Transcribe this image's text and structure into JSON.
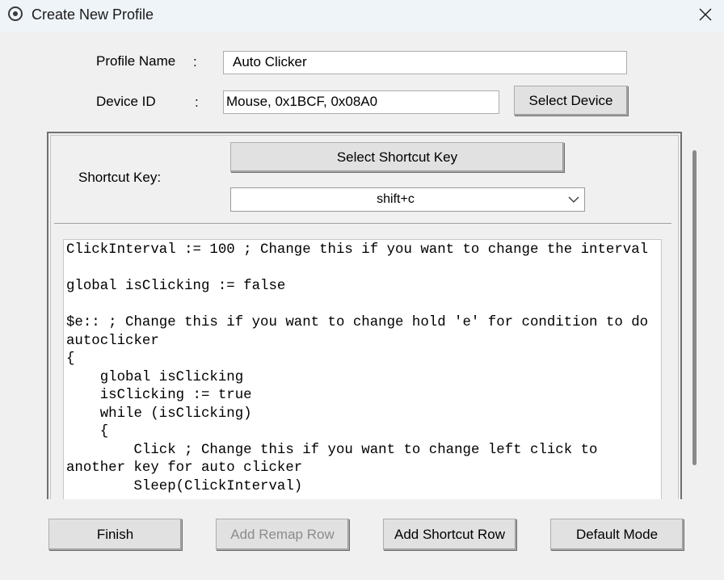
{
  "window": {
    "title": "Create New Profile",
    "icon": "radio-dot-icon",
    "close_icon": "close-icon"
  },
  "form": {
    "profile_name_label": "Profile Name",
    "profile_name_colon": ":",
    "profile_name_value": "Auto Clicker",
    "device_id_label": "Device ID",
    "device_id_colon": ":",
    "device_id_value": "Mouse, 0x1BCF, 0x08A0",
    "select_device_label": "Select Device"
  },
  "shortcut": {
    "label": "Shortcut Key:",
    "select_button_label": "Select Shortcut Key",
    "selected_value": "shift+c"
  },
  "script_lines": [
    "ClickInterval := 100 ; Change this if you want to change the interval",
    "",
    "global isClicking := false",
    "",
    "$e:: ; Change this if you want to change hold 'e' for condition to do autoclicker",
    "{",
    "    global isClicking",
    "    isClicking := true",
    "    while (isClicking)",
    "    {",
    "        Click ; Change this if you want to change left click to another key for auto clicker",
    "        Sleep(ClickInterval)"
  ],
  "footer": {
    "finish_label": "Finish",
    "add_remap_row_label": "Add Remap Row",
    "add_shortcut_row_label": "Add Shortcut Row",
    "default_mode_label": "Default Mode"
  },
  "colors": {
    "titlebar_bg": "#eff4f9",
    "window_bg": "#f0f0f0",
    "button_bg": "#e1e1e1",
    "disabled_text": "#8c8c8c"
  }
}
